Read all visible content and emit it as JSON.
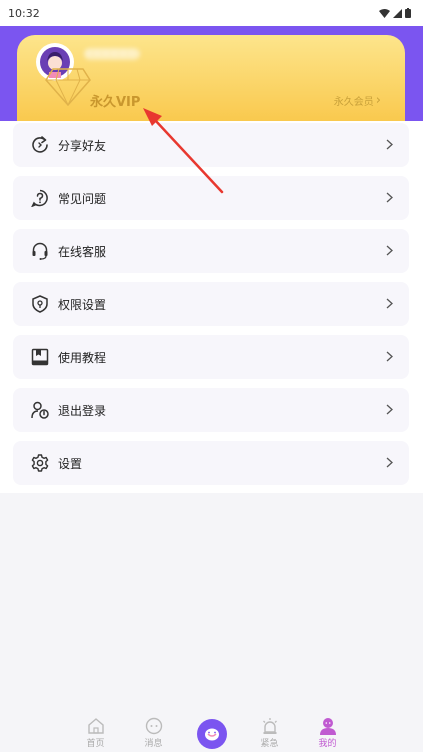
{
  "status_bar": {
    "time": "10:32"
  },
  "profile": {
    "username": "●●●●●●●●"
  },
  "vip": {
    "title": "永久VIP",
    "link_label": "永久会员",
    "link_chevron": "›"
  },
  "menu": {
    "items": [
      {
        "label": "分享好友",
        "icon": "share-refresh-icon"
      },
      {
        "label": "常见问题",
        "icon": "question-icon"
      },
      {
        "label": "在线客服",
        "icon": "headset-icon"
      },
      {
        "label": "权限设置",
        "icon": "shield-icon"
      },
      {
        "label": "使用教程",
        "icon": "book-icon"
      },
      {
        "label": "退出登录",
        "icon": "logout-user-icon"
      },
      {
        "label": "设置",
        "icon": "gear-icon"
      }
    ]
  },
  "tabs": [
    {
      "label": "首页",
      "icon": "home-icon"
    },
    {
      "label": "消息",
      "icon": "message-icon"
    },
    {
      "label": "",
      "icon": "center-face-icon"
    },
    {
      "label": "紧急",
      "icon": "alarm-icon"
    },
    {
      "label": "我的",
      "icon": "profile-icon"
    }
  ],
  "colors": {
    "header": "#7b55f0",
    "vip_gold_light": "#fde58c",
    "vip_gold_dark": "#f9c94e",
    "vip_text": "#c9972e",
    "tab_active": "#c05ad1",
    "annotation_arrow": "#e8382f"
  }
}
